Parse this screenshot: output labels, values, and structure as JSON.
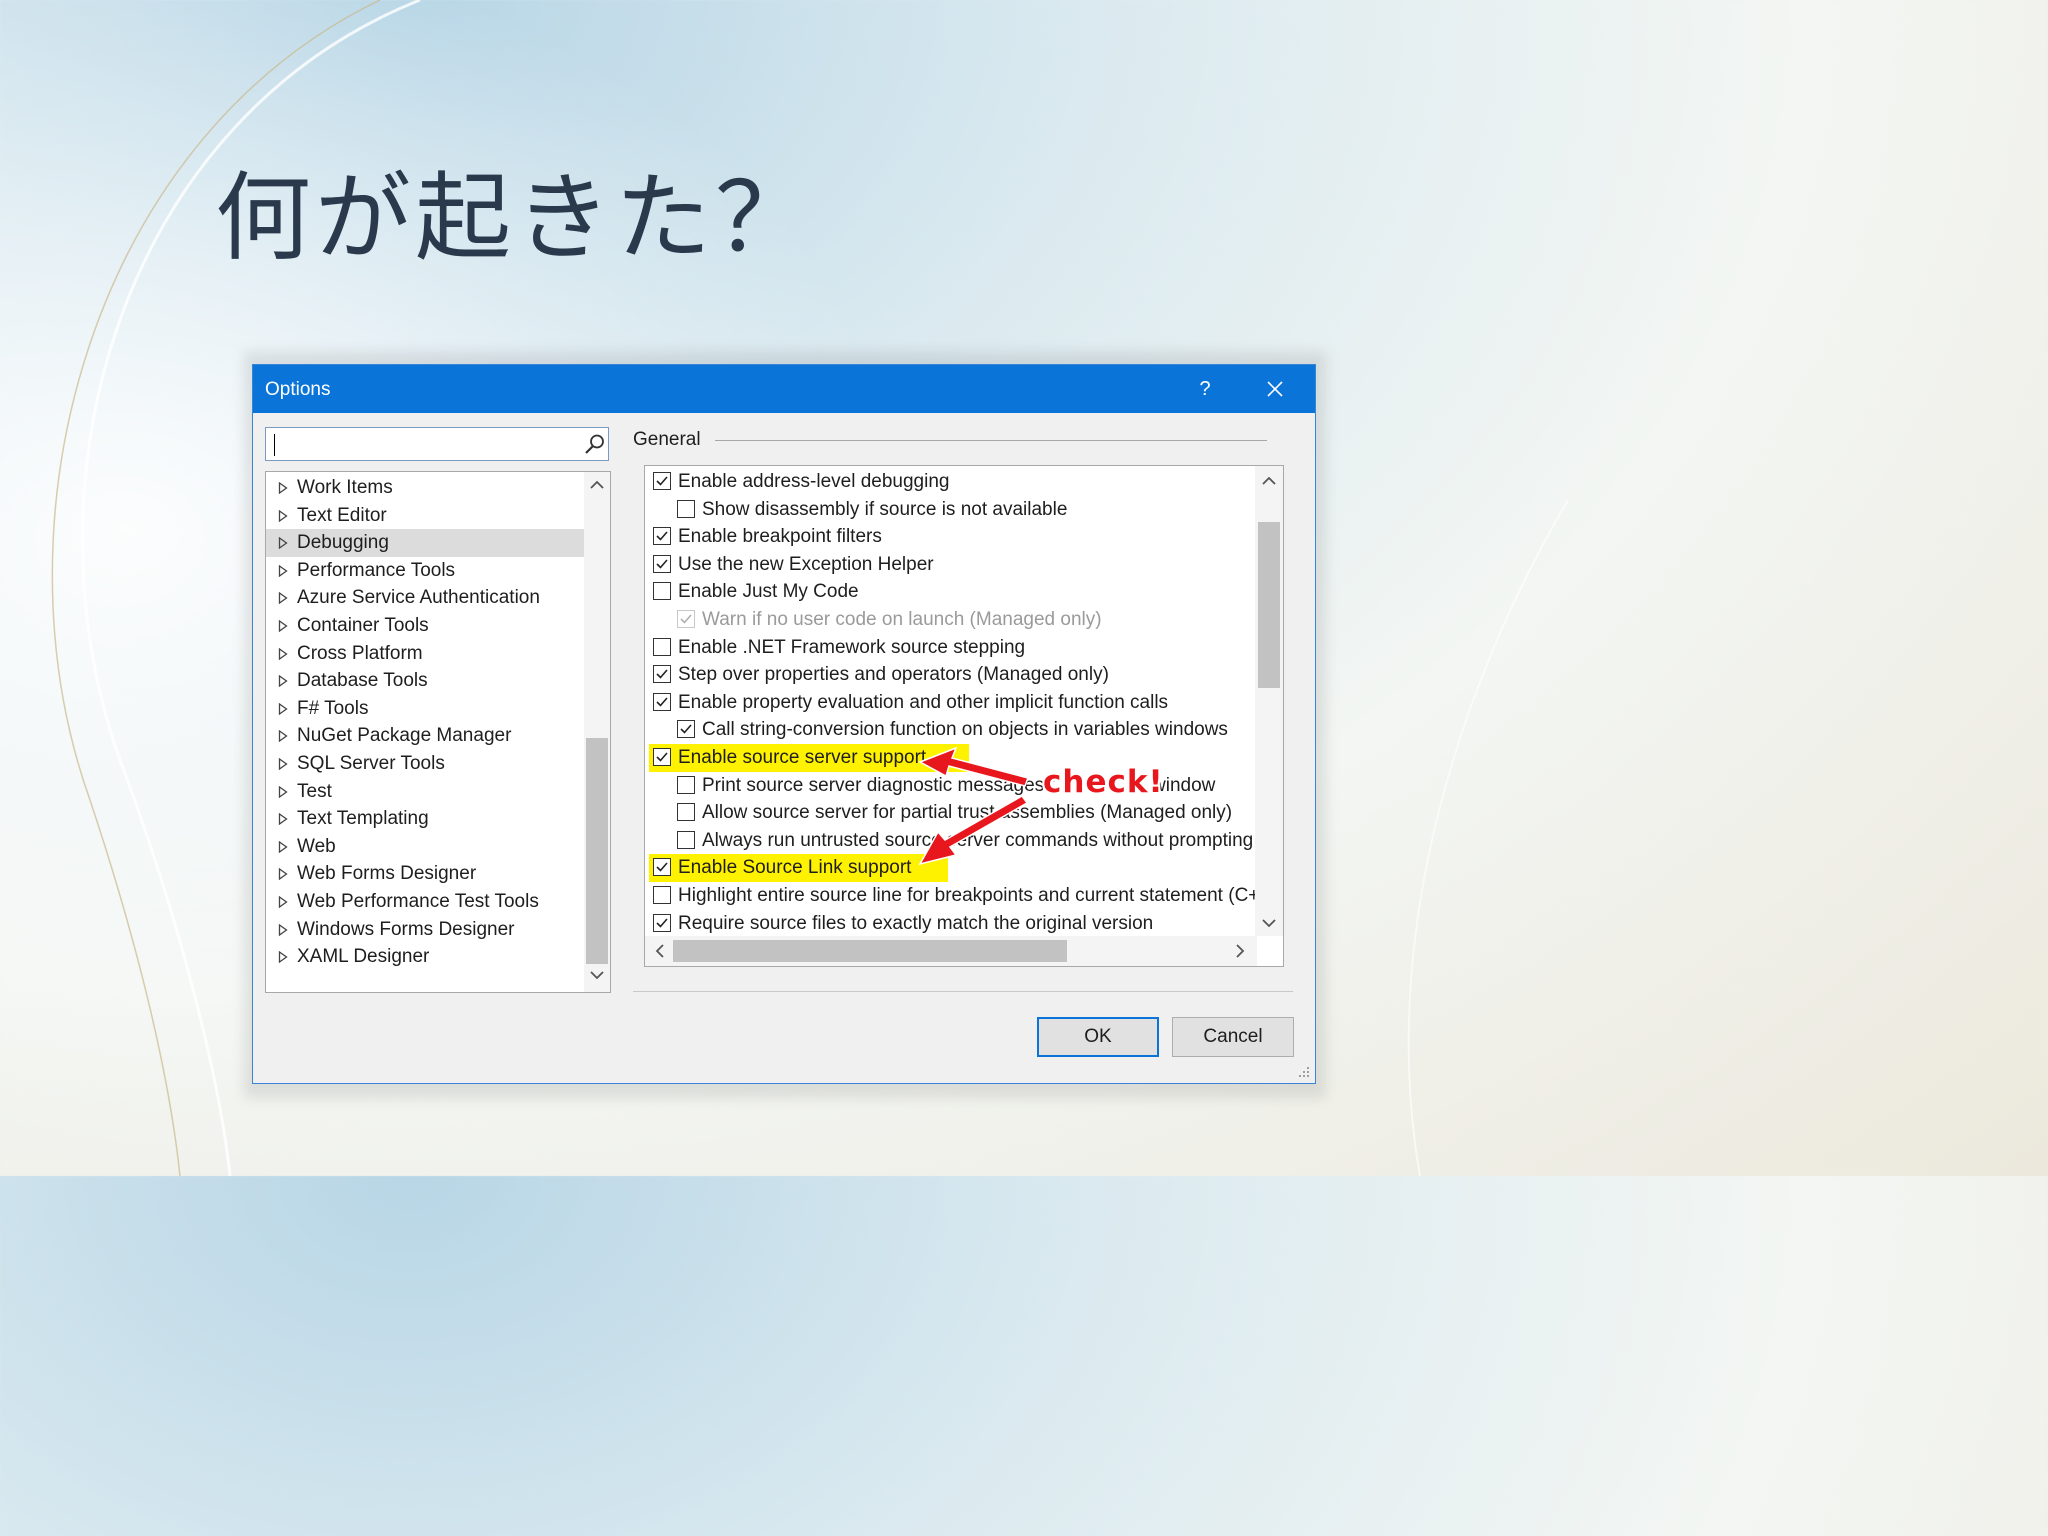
{
  "slide": {
    "title": "何が起きた？"
  },
  "dialog": {
    "title": "Options",
    "help_label": "?",
    "search": {
      "value": "",
      "placeholder": ""
    },
    "tree": {
      "items": [
        {
          "label": "Work Items",
          "selected": false
        },
        {
          "label": "Text Editor",
          "selected": false
        },
        {
          "label": "Debugging",
          "selected": true
        },
        {
          "label": "Performance Tools",
          "selected": false
        },
        {
          "label": "Azure Service Authentication",
          "selected": false
        },
        {
          "label": "Container Tools",
          "selected": false
        },
        {
          "label": "Cross Platform",
          "selected": false
        },
        {
          "label": "Database Tools",
          "selected": false
        },
        {
          "label": "F# Tools",
          "selected": false
        },
        {
          "label": "NuGet Package Manager",
          "selected": false
        },
        {
          "label": "SQL Server Tools",
          "selected": false
        },
        {
          "label": "Test",
          "selected": false
        },
        {
          "label": "Text Templating",
          "selected": false
        },
        {
          "label": "Web",
          "selected": false
        },
        {
          "label": "Web Forms Designer",
          "selected": false
        },
        {
          "label": "Web Performance Test Tools",
          "selected": false
        },
        {
          "label": "Windows Forms Designer",
          "selected": false
        },
        {
          "label": "XAML Designer",
          "selected": false
        }
      ]
    },
    "section": "General",
    "options": [
      {
        "label": "Enable address-level debugging",
        "checked": true,
        "indent": 0,
        "disabled": false,
        "highlighted": false
      },
      {
        "label": "Show disassembly if source is not available",
        "checked": false,
        "indent": 1,
        "disabled": false,
        "highlighted": false
      },
      {
        "label": "Enable breakpoint filters",
        "checked": true,
        "indent": 0,
        "disabled": false,
        "highlighted": false
      },
      {
        "label": "Use the new Exception Helper",
        "checked": true,
        "indent": 0,
        "disabled": false,
        "highlighted": false
      },
      {
        "label": "Enable Just My Code",
        "checked": false,
        "indent": 0,
        "disabled": false,
        "highlighted": false
      },
      {
        "label": "Warn if no user code on launch (Managed only)",
        "checked": true,
        "indent": 1,
        "disabled": true,
        "highlighted": false
      },
      {
        "label": "Enable .NET Framework source stepping",
        "checked": false,
        "indent": 0,
        "disabled": false,
        "highlighted": false
      },
      {
        "label": "Step over properties and operators (Managed only)",
        "checked": true,
        "indent": 0,
        "disabled": false,
        "highlighted": false
      },
      {
        "label": "Enable property evaluation and other implicit function calls",
        "checked": true,
        "indent": 0,
        "disabled": false,
        "highlighted": false
      },
      {
        "label": "Call string-conversion function on objects in variables windows",
        "checked": true,
        "indent": 1,
        "disabled": false,
        "highlighted": false
      },
      {
        "label": "Enable source server support",
        "checked": true,
        "indent": 0,
        "disabled": false,
        "highlighted": true
      },
      {
        "label": "Print source server diagnostic messages t",
        "checked": false,
        "indent": 1,
        "disabled": false,
        "highlighted": false,
        "hidden_suffix": "window"
      },
      {
        "label": "Allow source server for partial trust assemblies (Managed only)",
        "checked": false,
        "indent": 1,
        "disabled": false,
        "highlighted": false
      },
      {
        "label": "Always run untrusted source server commands without prompting",
        "checked": false,
        "indent": 1,
        "disabled": false,
        "highlighted": false
      },
      {
        "label": "Enable Source Link support",
        "checked": true,
        "indent": 0,
        "disabled": false,
        "highlighted": true
      },
      {
        "label": "Highlight entire source line for breakpoints and current statement (C+",
        "checked": false,
        "indent": 0,
        "disabled": false,
        "highlighted": false
      },
      {
        "label": "Require source files to exactly match the original version",
        "checked": true,
        "indent": 0,
        "disabled": false,
        "highlighted": false
      }
    ],
    "buttons": {
      "ok": "OK",
      "cancel": "Cancel"
    }
  },
  "annotation": {
    "text": "check!",
    "color": "#e8171d",
    "highlight_color": "#fff200"
  },
  "colors": {
    "titlebar": "#0a74d8",
    "slide_title": "#2a3a4c"
  }
}
